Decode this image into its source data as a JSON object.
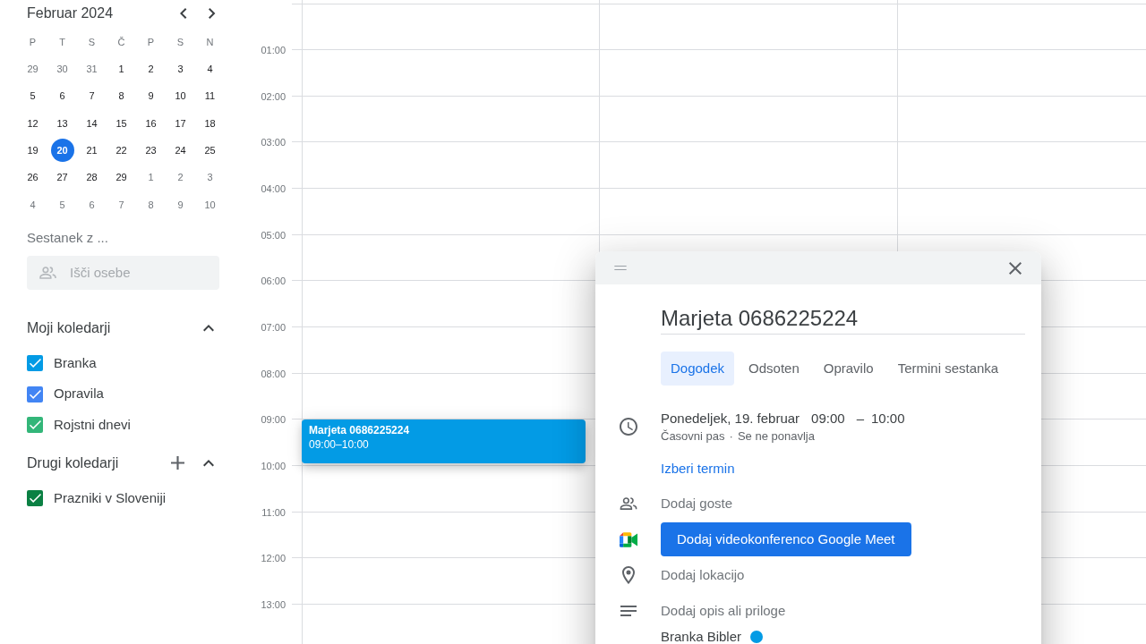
{
  "mini_calendar": {
    "title": "Februar 2024",
    "weekdays": [
      "P",
      "T",
      "S",
      "Č",
      "P",
      "S",
      "N"
    ],
    "weeks": [
      [
        {
          "label": "29",
          "other_month": true,
          "selected": false
        },
        {
          "label": "30",
          "other_month": true,
          "selected": false
        },
        {
          "label": "31",
          "other_month": true,
          "selected": false
        },
        {
          "label": "1",
          "other_month": false,
          "selected": false
        },
        {
          "label": "2",
          "other_month": false,
          "selected": false
        },
        {
          "label": "3",
          "other_month": false,
          "selected": false
        },
        {
          "label": "4",
          "other_month": false,
          "selected": false
        }
      ],
      [
        {
          "label": "5",
          "other_month": false,
          "selected": false
        },
        {
          "label": "6",
          "other_month": false,
          "selected": false
        },
        {
          "label": "7",
          "other_month": false,
          "selected": false
        },
        {
          "label": "8",
          "other_month": false,
          "selected": false
        },
        {
          "label": "9",
          "other_month": false,
          "selected": false
        },
        {
          "label": "10",
          "other_month": false,
          "selected": false
        },
        {
          "label": "11",
          "other_month": false,
          "selected": false
        }
      ],
      [
        {
          "label": "12",
          "other_month": false,
          "selected": false
        },
        {
          "label": "13",
          "other_month": false,
          "selected": false
        },
        {
          "label": "14",
          "other_month": false,
          "selected": false
        },
        {
          "label": "15",
          "other_month": false,
          "selected": false
        },
        {
          "label": "16",
          "other_month": false,
          "selected": false
        },
        {
          "label": "17",
          "other_month": false,
          "selected": false
        },
        {
          "label": "18",
          "other_month": false,
          "selected": false
        }
      ],
      [
        {
          "label": "19",
          "other_month": false,
          "selected": false
        },
        {
          "label": "20",
          "other_month": false,
          "selected": true
        },
        {
          "label": "21",
          "other_month": false,
          "selected": false
        },
        {
          "label": "22",
          "other_month": false,
          "selected": false
        },
        {
          "label": "23",
          "other_month": false,
          "selected": false
        },
        {
          "label": "24",
          "other_month": false,
          "selected": false
        },
        {
          "label": "25",
          "other_month": false,
          "selected": false
        }
      ],
      [
        {
          "label": "26",
          "other_month": false,
          "selected": false
        },
        {
          "label": "27",
          "other_month": false,
          "selected": false
        },
        {
          "label": "28",
          "other_month": false,
          "selected": false
        },
        {
          "label": "29",
          "other_month": false,
          "selected": false
        },
        {
          "label": "1",
          "other_month": true,
          "selected": false
        },
        {
          "label": "2",
          "other_month": true,
          "selected": false
        },
        {
          "label": "3",
          "other_month": true,
          "selected": false
        }
      ],
      [
        {
          "label": "4",
          "other_month": true,
          "selected": false
        },
        {
          "label": "5",
          "other_month": true,
          "selected": false
        },
        {
          "label": "6",
          "other_month": true,
          "selected": false
        },
        {
          "label": "7",
          "other_month": true,
          "selected": false
        },
        {
          "label": "8",
          "other_month": true,
          "selected": false
        },
        {
          "label": "9",
          "other_month": true,
          "selected": false
        },
        {
          "label": "10",
          "other_month": true,
          "selected": false
        }
      ]
    ]
  },
  "people_search": {
    "label": "Sestanek z ...",
    "placeholder": "Išči osebe"
  },
  "calendar_groups": [
    {
      "title": "Moji koledarji",
      "expanded": true,
      "add_button": false,
      "calendars": [
        {
          "name": "Branka",
          "checked": true,
          "color": "#039be5"
        },
        {
          "name": "Opravila",
          "checked": true,
          "color": "#4285f4"
        },
        {
          "name": "Rojstni dnevi",
          "checked": true,
          "color": "#33b679"
        }
      ]
    },
    {
      "title": "Drugi koledarji",
      "expanded": true,
      "add_button": true,
      "calendars": [
        {
          "name": "Prazniki v Sloveniji",
          "checked": true,
          "color": "#0b8043"
        }
      ]
    }
  ],
  "time_grid": {
    "hours": [
      "01:00",
      "02:00",
      "03:00",
      "04:00",
      "05:00",
      "06:00",
      "07:00",
      "08:00",
      "09:00",
      "10:00",
      "11:00",
      "12:00",
      "13:00"
    ]
  },
  "events": [
    {
      "title": "Marjeta 0686225224",
      "time": "09:00–10:00",
      "color": "#039be5"
    }
  ],
  "dialog": {
    "title": "Marjeta 0686225224",
    "tabs": [
      {
        "label": "Dogodek",
        "selected": true
      },
      {
        "label": "Odsoten",
        "selected": false
      },
      {
        "label": "Opravilo",
        "selected": false
      },
      {
        "label": "Termini sestanka",
        "selected": false
      }
    ],
    "date": "Ponedeljek, 19. februar",
    "start_time": "09:00",
    "dash": "–",
    "end_time": "10:00",
    "timezone": "Časovni pas",
    "separator": "·",
    "recurrence": "Se ne ponavlja",
    "find_time": "Izberi termin",
    "guests": {
      "placeholder": "Dodaj goste"
    },
    "meet_button": "Dodaj videokonferenco Google Meet",
    "location": {
      "placeholder": "Dodaj lokacijo"
    },
    "description": {
      "placeholder": "Dodaj opis ali priloge"
    },
    "organizer": {
      "name": "Branka Bibler",
      "color": "#039be5"
    }
  }
}
